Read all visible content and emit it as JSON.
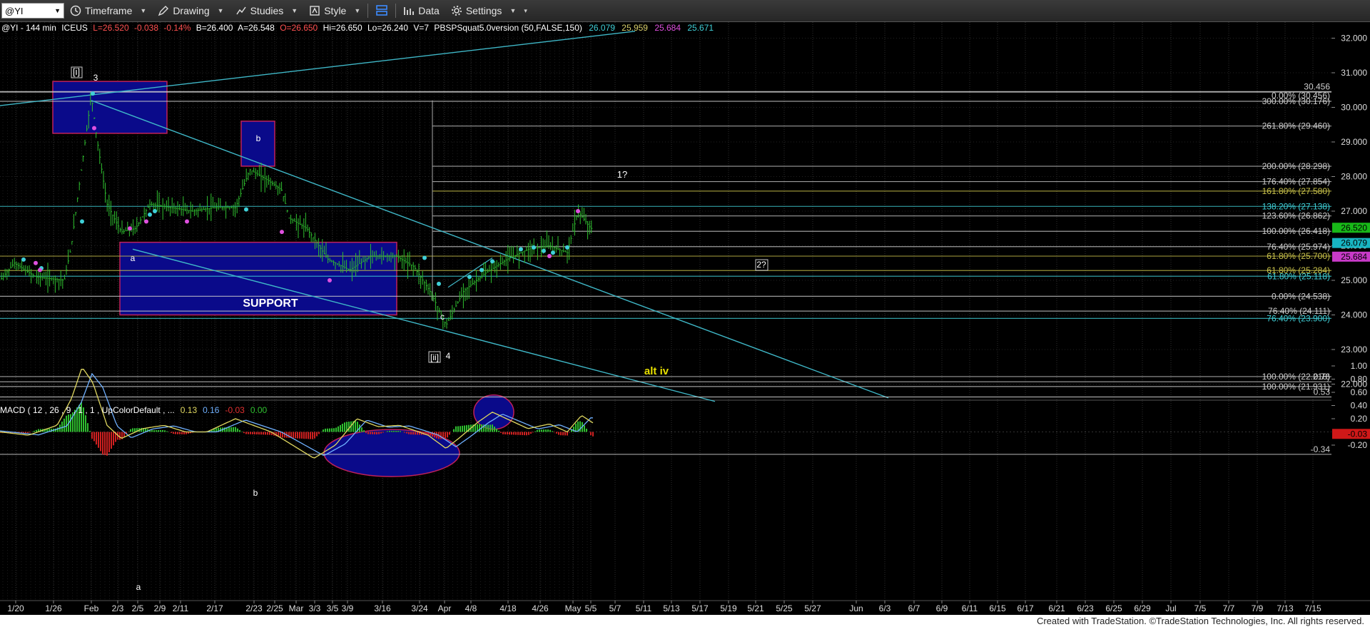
{
  "toolbar": {
    "symbol": "@YI",
    "timeframe": "Timeframe",
    "drawing": "Drawing",
    "studies": "Studies",
    "style": "Style",
    "data": "Data",
    "settings": "Settings"
  },
  "header": {
    "symbol": "@YI - 144 min",
    "exchange": "ICEUS",
    "last": "L=26.520",
    "change": "-0.038",
    "change_pct": "-0.14%",
    "bid": "B=26.400",
    "ask": "A=26.548",
    "open": "O=26.650",
    "high": "Hi=26.650",
    "low": "Lo=26.240",
    "volume": "V=7",
    "study": "PBSPSquat5.0version (50,FALSE,150)",
    "study_values": [
      {
        "v": "26.079",
        "color": "#3fd0d8"
      },
      {
        "v": "25.959",
        "color": "#d8cf6a"
      },
      {
        "v": "25.684",
        "color": "#e050e0"
      },
      {
        "v": "25.671",
        "color": "#3fd0d8"
      }
    ]
  },
  "price_axis": [
    "32.000",
    "31.000",
    "30.000",
    "29.000",
    "28.000",
    "27.000",
    "26.000",
    "25.000",
    "24.000",
    "23.000",
    "22.000"
  ],
  "price_tags": [
    {
      "v": "26.520",
      "bg": "#18b818",
      "fg": "#000"
    },
    {
      "v": "26.079",
      "bg": "#17b5c2",
      "fg": "#000"
    },
    {
      "v": "25.684",
      "bg": "#c83ac8",
      "fg": "#000"
    }
  ],
  "fib_levels": [
    {
      "text": "30.456",
      "color": "#cfcfcf"
    },
    {
      "text": "0.00% (30.456)",
      "color": "#cfcfcf"
    },
    {
      "text": "300.00% (30.176)",
      "color": "#cfcfcf"
    },
    {
      "text": "261.80% (29.460)",
      "color": "#cfcfcf"
    },
    {
      "text": "200.00% (28.298)",
      "color": "#cfcfcf"
    },
    {
      "text": "176.40% (27.854)",
      "color": "#cfcfcf"
    },
    {
      "text": "161.80% (27.580)",
      "color": "#c9c24a"
    },
    {
      "text": "138.20% (27.138)",
      "color": "#3fd0d8"
    },
    {
      "text": "123.60% (26.862)",
      "color": "#cfcfcf"
    },
    {
      "text": "100.00% (26.418)",
      "color": "#cfcfcf"
    },
    {
      "text": "76.40% (25.974)",
      "color": "#cfcfcf"
    },
    {
      "text": "61.80% (25.700)",
      "color": "#c9c24a"
    },
    {
      "text": "61.80% (25.284)",
      "color": "#c9c24a"
    },
    {
      "text": "61.80% (25.118)",
      "color": "#3fd0d8"
    },
    {
      "text": "0.00% (24.538)",
      "color": "#cfcfcf"
    },
    {
      "text": "76.40% (24.111)",
      "color": "#cfcfcf"
    },
    {
      "text": "76.40% (23.900)",
      "color": "#3fd0d8"
    },
    {
      "text": "100.00% (22.218)",
      "color": "#cfcfcf"
    },
    {
      "text": "100.00% (21.931)",
      "color": "#cfcfcf"
    }
  ],
  "annotations": [
    {
      "text": "[i]",
      "color": "#ffffff"
    },
    {
      "text": "3",
      "color": "#ffffff"
    },
    {
      "text": "b",
      "color": "#ffffff"
    },
    {
      "text": "a",
      "color": "#ffffff"
    },
    {
      "text": "SUPPORT",
      "color": "#ffffff"
    },
    {
      "text": "c",
      "color": "#ffffff"
    },
    {
      "text": "[ii]",
      "color": "#ffffff"
    },
    {
      "text": "4",
      "color": "#ffffff"
    },
    {
      "text": "1?",
      "color": "#ffffff"
    },
    {
      "text": "2?",
      "color": "#ffffff"
    },
    {
      "text": "alt iv",
      "color": "#e8e000"
    }
  ],
  "macd": {
    "label": "MACD ( 12 , 26 , 9 , 1 , 1 , UpColorDefault , ...",
    "values": [
      {
        "v": "0.13",
        "color": "#e0d860"
      },
      {
        "v": "0.16",
        "color": "#6fb0ff"
      },
      {
        "v": "-0.03",
        "color": "#e03030"
      },
      {
        "v": "0.00",
        "color": "#30c030"
      }
    ],
    "axis": [
      "1.00",
      "0.80",
      "0.60",
      "0.40",
      "0.20",
      "-0.20"
    ],
    "levels": [
      "0.76",
      "0.53",
      "-0.34"
    ],
    "tag": "-0.03",
    "annotations": [
      "b",
      "a"
    ]
  },
  "date_axis": [
    "1/20",
    "1/26",
    "Feb",
    "2/3",
    "2/5",
    "2/9",
    "2/11",
    "2/17",
    "2/23",
    "2/25",
    "Mar",
    "3/3",
    "3/5",
    "3/9",
    "3/16",
    "3/24",
    "Apr",
    "4/8",
    "4/18",
    "4/26",
    "May",
    "5/5",
    "5/7",
    "5/11",
    "5/13",
    "5/17",
    "5/19",
    "5/21",
    "5/25",
    "5/27",
    "Jun",
    "6/3",
    "6/7",
    "6/9",
    "6/11",
    "6/15",
    "6/17",
    "6/21",
    "6/23",
    "6/25",
    "6/29",
    "Jul",
    "7/5",
    "7/7",
    "7/9",
    "7/13",
    "7/15"
  ],
  "footer": "Created with TradeStation. ©TradeStation Technologies, Inc. All rights reserved."
}
